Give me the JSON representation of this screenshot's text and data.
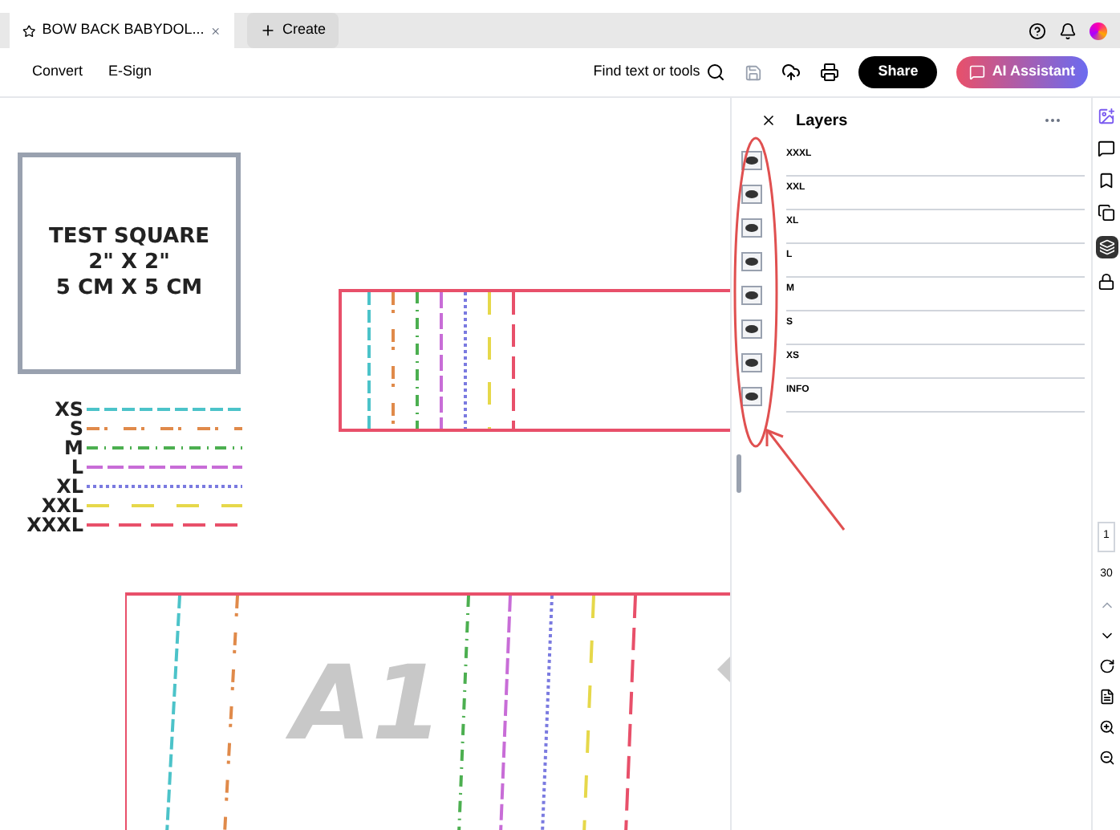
{
  "tabs": [
    {
      "label": "BOW BACK BABYDOL...",
      "selected": true,
      "kind": "document"
    },
    {
      "label": "Create",
      "selected": false,
      "kind": "new"
    }
  ],
  "toolbar": {
    "menu": [
      "Convert",
      "E-Sign"
    ],
    "search": "Find text or tools",
    "share": "Share",
    "assistant": "AI Assistant"
  },
  "document": {
    "test_square": [
      "TEST SQUARE",
      "2\" X 2\"",
      "5 CM X 5 CM"
    ],
    "legend": [
      {
        "label": "XS",
        "color": "#4cc3c9"
      },
      {
        "label": "S",
        "color": "#e08a4a"
      },
      {
        "label": "M",
        "color": "#4caf50"
      },
      {
        "label": "L",
        "color": "#c86dd7"
      },
      {
        "label": "XL",
        "color": "#7a7ae0"
      },
      {
        "label": "XXL",
        "color": "#e6d84a"
      },
      {
        "label": "XXXL",
        "color": "#e8506a"
      }
    ],
    "piece_label": "A1"
  },
  "layers": {
    "title": "Layers",
    "items": [
      {
        "name": "XXXL",
        "visible": true
      },
      {
        "name": "XXL",
        "visible": true
      },
      {
        "name": "XL",
        "visible": true
      },
      {
        "name": "L",
        "visible": true
      },
      {
        "name": "M",
        "visible": true
      },
      {
        "name": "S",
        "visible": true
      },
      {
        "name": "XS",
        "visible": true
      },
      {
        "name": "INFO",
        "visible": true
      }
    ]
  },
  "page": {
    "current": "1",
    "total": "30"
  }
}
